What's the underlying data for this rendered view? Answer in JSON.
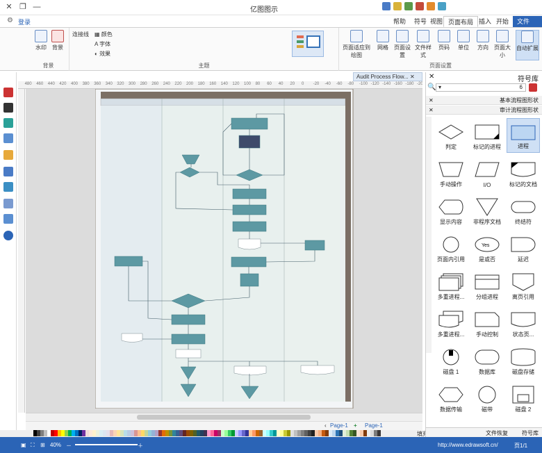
{
  "app": {
    "title": "亿图图示",
    "login": "登录"
  },
  "tabs": [
    "文件",
    "开始",
    "插入",
    "页面布局",
    "视图",
    "符号",
    "帮助"
  ],
  "ribbon": {
    "groups": [
      {
        "label": "页面设置"
      },
      {
        "label": "主题"
      },
      {
        "label": "背景"
      }
    ],
    "page_setup_buttons": [
      "自动扩展",
      "页面大小",
      "方向",
      "单位",
      "页码",
      "文件样式",
      "页面设置",
      "网格",
      "页面适应到绘图"
    ],
    "theme_items": [
      "颜色",
      "字体",
      "效果",
      "连接线"
    ],
    "background_buttons": [
      "背景",
      "水印"
    ]
  },
  "document_tab": "Audit Process Flow...",
  "ruler_ticks": [
    "-200",
    "-180",
    "-160",
    "-140",
    "-120",
    "-100",
    "-80",
    "-60",
    "-40",
    "-20",
    "0",
    "20",
    "40",
    "60",
    "80",
    "100",
    "120",
    "140",
    "160",
    "180",
    "200",
    "220",
    "240",
    "260",
    "280",
    "300",
    "320",
    "340",
    "360",
    "380",
    "400",
    "420",
    "440",
    "460",
    "480"
  ],
  "right_panel": {
    "title": "符号库",
    "search_value": "6",
    "sections": [
      "基本流程图形状",
      "审计流程图形状"
    ],
    "shapes": [
      {
        "label": "进程",
        "shape": "rect"
      },
      {
        "label": "标记的进程",
        "shape": "rect-tag"
      },
      {
        "label": "判定",
        "shape": "diamond"
      },
      {
        "label": "标记的文档",
        "shape": "doc-tag"
      },
      {
        "label": "I/O",
        "shape": "parallelogram"
      },
      {
        "label": "手动操作",
        "shape": "trapezoid"
      },
      {
        "label": "终结符",
        "shape": "pill"
      },
      {
        "label": "非程序文档",
        "shape": "triangle-down"
      },
      {
        "label": "显示内容",
        "shape": "display"
      },
      {
        "label": "延迟",
        "shape": "delay"
      },
      {
        "label": "是或否",
        "shape": "ellipse"
      },
      {
        "label": "页面内引用",
        "shape": "circle"
      },
      {
        "label": "离页引用",
        "shape": "pentagon"
      },
      {
        "label": "分组进程",
        "shape": "rect-split"
      },
      {
        "label": "多重进程...",
        "shape": "multi"
      },
      {
        "label": "状态页...",
        "shape": "card"
      },
      {
        "label": "手动控制",
        "shape": "card2"
      },
      {
        "label": "多重进程...",
        "shape": "multidoc"
      },
      {
        "label": "磁盘存储",
        "shape": "cylinder"
      },
      {
        "label": "数据库",
        "shape": "drum"
      },
      {
        "label": "磁盘 1",
        "shape": "disk"
      },
      {
        "label": "磁盘 2",
        "shape": "disk2"
      },
      {
        "label": "磁带",
        "shape": "circle2"
      },
      {
        "label": "数据传输",
        "shape": "hexagon"
      }
    ],
    "bottom_tabs": [
      "符号库",
      "文件恢复"
    ]
  },
  "page_bar": {
    "page1": "Page-1",
    "page1_tab": "Page-1"
  },
  "palette_label": "填充",
  "status": {
    "url": "http://www.edrawsoft.cn/",
    "page": "页1/1",
    "zoom": "40%"
  },
  "palette": [
    "#000000",
    "#3f3f3f",
    "#7f7f7f",
    "#bfbfbf",
    "#ffffff",
    "#c00000",
    "#ff0000",
    "#ffc000",
    "#ffff00",
    "#92d050",
    "#00b050",
    "#00b0f0",
    "#0070c0",
    "#002060",
    "#7030a0",
    "#f2dcdb",
    "#fde9d9",
    "#fff2cc",
    "#ebf1dd",
    "#dbeef3",
    "#dce6f1",
    "#e5e0ec",
    "#e6b9b8",
    "#fbd4b4",
    "#ffe599",
    "#d7e4bc",
    "#b7dde8",
    "#b8cce4",
    "#ccc0da",
    "#d99694",
    "#fac08f",
    "#ffd966",
    "#c3d69b",
    "#92cddc",
    "#95b3d7",
    "#b2a1c7",
    "#953734",
    "#e36c09",
    "#bf9000",
    "#76923c",
    "#31859b",
    "#366092",
    "#5f497a",
    "#632423",
    "#974806",
    "#7f6000",
    "#4f6228",
    "#205867",
    "#244061",
    "#3f3151",
    "#ff99cc",
    "#ff6699",
    "#cc0066",
    "#993366",
    "#ccffcc",
    "#99ff99",
    "#33cc66",
    "#009933",
    "#ccccff",
    "#9999ff",
    "#6666cc",
    "#333399",
    "#ffcc99",
    "#ff9966",
    "#cc6600",
    "#996633",
    "#ccffff",
    "#99ffff",
    "#33cccc",
    "#009999",
    "#ffffcc",
    "#ffff99",
    "#cccc33",
    "#999900",
    "#e0e0e0",
    "#c0c0c0",
    "#a0a0a0",
    "#808080",
    "#606060",
    "#404040",
    "#202020",
    "#f7caac",
    "#f4b083",
    "#c55a11",
    "#843c0c",
    "#deebf6",
    "#bdd6ee",
    "#2e75b5",
    "#1e4e79",
    "#e2efd9",
    "#c5e0b3",
    "#538135",
    "#375623",
    "#fbe4d5",
    "#f7cbac",
    "#823b0b",
    "#ededed",
    "#dbdbdb",
    "#7b7b7b",
    "#3b3838"
  ]
}
